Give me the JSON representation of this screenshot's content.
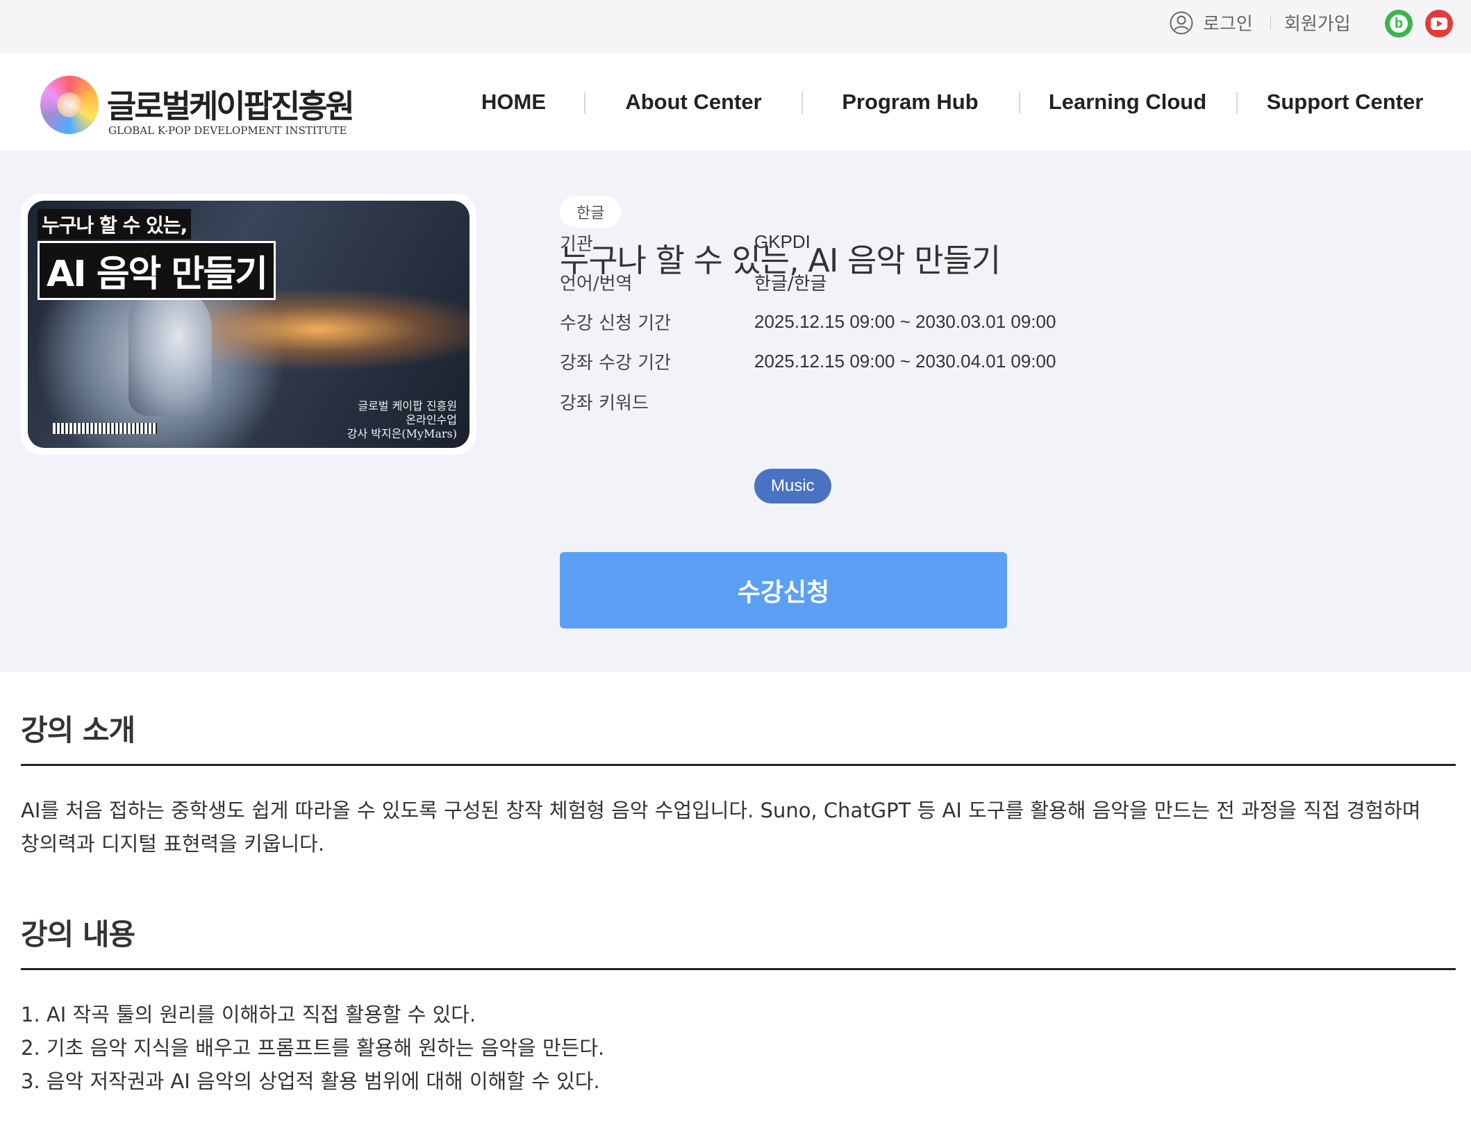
{
  "utility": {
    "login_label": "로그인",
    "signup_label": "회원가입",
    "social": [
      {
        "icon": "blog-icon",
        "glyph": "b",
        "color": "#3bb54a"
      },
      {
        "icon": "youtube-icon",
        "color": "#e53a3a"
      }
    ]
  },
  "header": {
    "logo_ko": "글로벌케이팝진흥원",
    "logo_en": "GLOBAL K-POP DEVELOPMENT INSTITUTE",
    "nav": [
      "HOME",
      "About Center",
      "Program Hub",
      "Learning Cloud",
      "Support Center"
    ]
  },
  "course": {
    "thumbnail": {
      "title_line1": "누구나 할 수 있는,",
      "title_line2": "AI 음악 만들기",
      "credit_line1": "글로벌 케이팝 진흥원",
      "credit_line2": "온라인수업",
      "credit_line3": "강사 박지은(MyMars)"
    },
    "language_badge": "한글",
    "title": "누구나 할 수 있는, AI 음악 만들기",
    "info": [
      {
        "label": "기관",
        "value": "GKPDI"
      },
      {
        "label": "언어/번역",
        "value": "한글/한글"
      },
      {
        "label": "수강 신청 기간",
        "value": "2025.12.15 09:00 ~ 2030.03.01 09:00"
      },
      {
        "label": "강좌 수강 기간",
        "value": "2025.12.15 09:00 ~ 2030.04.01 09:00"
      },
      {
        "label": "강좌 키워드",
        "value": "Music"
      }
    ],
    "apply_button": "수강신청"
  },
  "sections": {
    "intro": {
      "heading": "강의 소개",
      "lines": [
        "AI를 처음 접하는 중학생도 쉽게 따라올 수 있도록 구성된 창작 체험형 음악 수업입니다. Suno, ChatGPT 등 AI 도구를 활용해 음악을 만드는 전 과정을 직접 경험하며",
        "창의력과 디지털 표현력을 키웁니다."
      ]
    },
    "content": {
      "heading": "강의 내용",
      "lines": [
        "1. AI 작곡 툴의 원리를 이해하고 직접 활용할 수 있다.",
        "2. 기초 음악 지식을 배우고 프롬프트를 활용해 원하는 음악을 만든다.",
        "3. 음악 저작권과 AI 음악의 상업적 활용 범위에 대해 이해할 수 있다."
      ]
    }
  },
  "colors": {
    "accent_button": "#5ba0f5",
    "keyword_chip": "#4a72c2",
    "hero_bg": "#f2f3f8"
  }
}
